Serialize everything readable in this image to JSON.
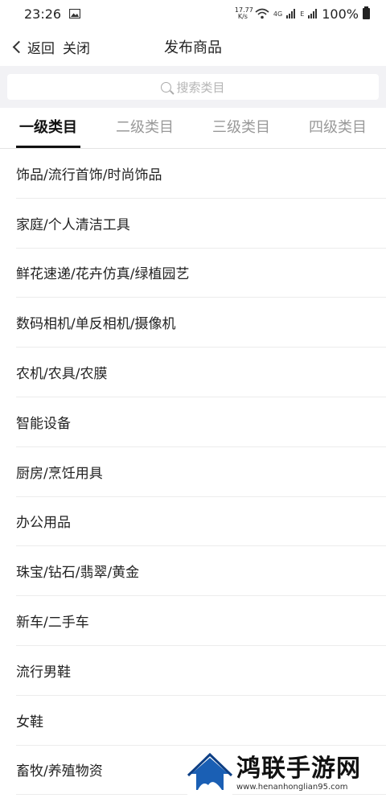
{
  "status_bar": {
    "time": "23:26",
    "net_speed_top": "17.77",
    "net_speed_bottom": "K/s",
    "signal_1": "4G",
    "signal_2": "E",
    "battery": "100%"
  },
  "nav": {
    "back_label": "返回",
    "close_label": "关闭",
    "title": "发布商品"
  },
  "search": {
    "placeholder": "搜索类目"
  },
  "tabs": [
    {
      "label": "一级类目",
      "active": true
    },
    {
      "label": "二级类目",
      "active": false
    },
    {
      "label": "三级类目",
      "active": false
    },
    {
      "label": "四级类目",
      "active": false
    }
  ],
  "categories": [
    "饰品/流行首饰/时尚饰品",
    "家庭/个人清洁工具",
    "鲜花速递/花卉仿真/绿植园艺",
    "数码相机/单反相机/摄像机",
    "农机/农具/农膜",
    "智能设备",
    "厨房/烹饪用具",
    "办公用品",
    "珠宝/钻石/翡翠/黄金",
    "新车/二手车",
    "流行男鞋",
    "女鞋",
    "畜牧/养殖物资"
  ],
  "watermark": {
    "title": "鸿联手游网",
    "url": "www.henanhonglian95.com"
  },
  "colors": {
    "text": "#222222",
    "muted": "#999999",
    "search_bg": "#f2f2f5",
    "divider": "#ececec"
  }
}
